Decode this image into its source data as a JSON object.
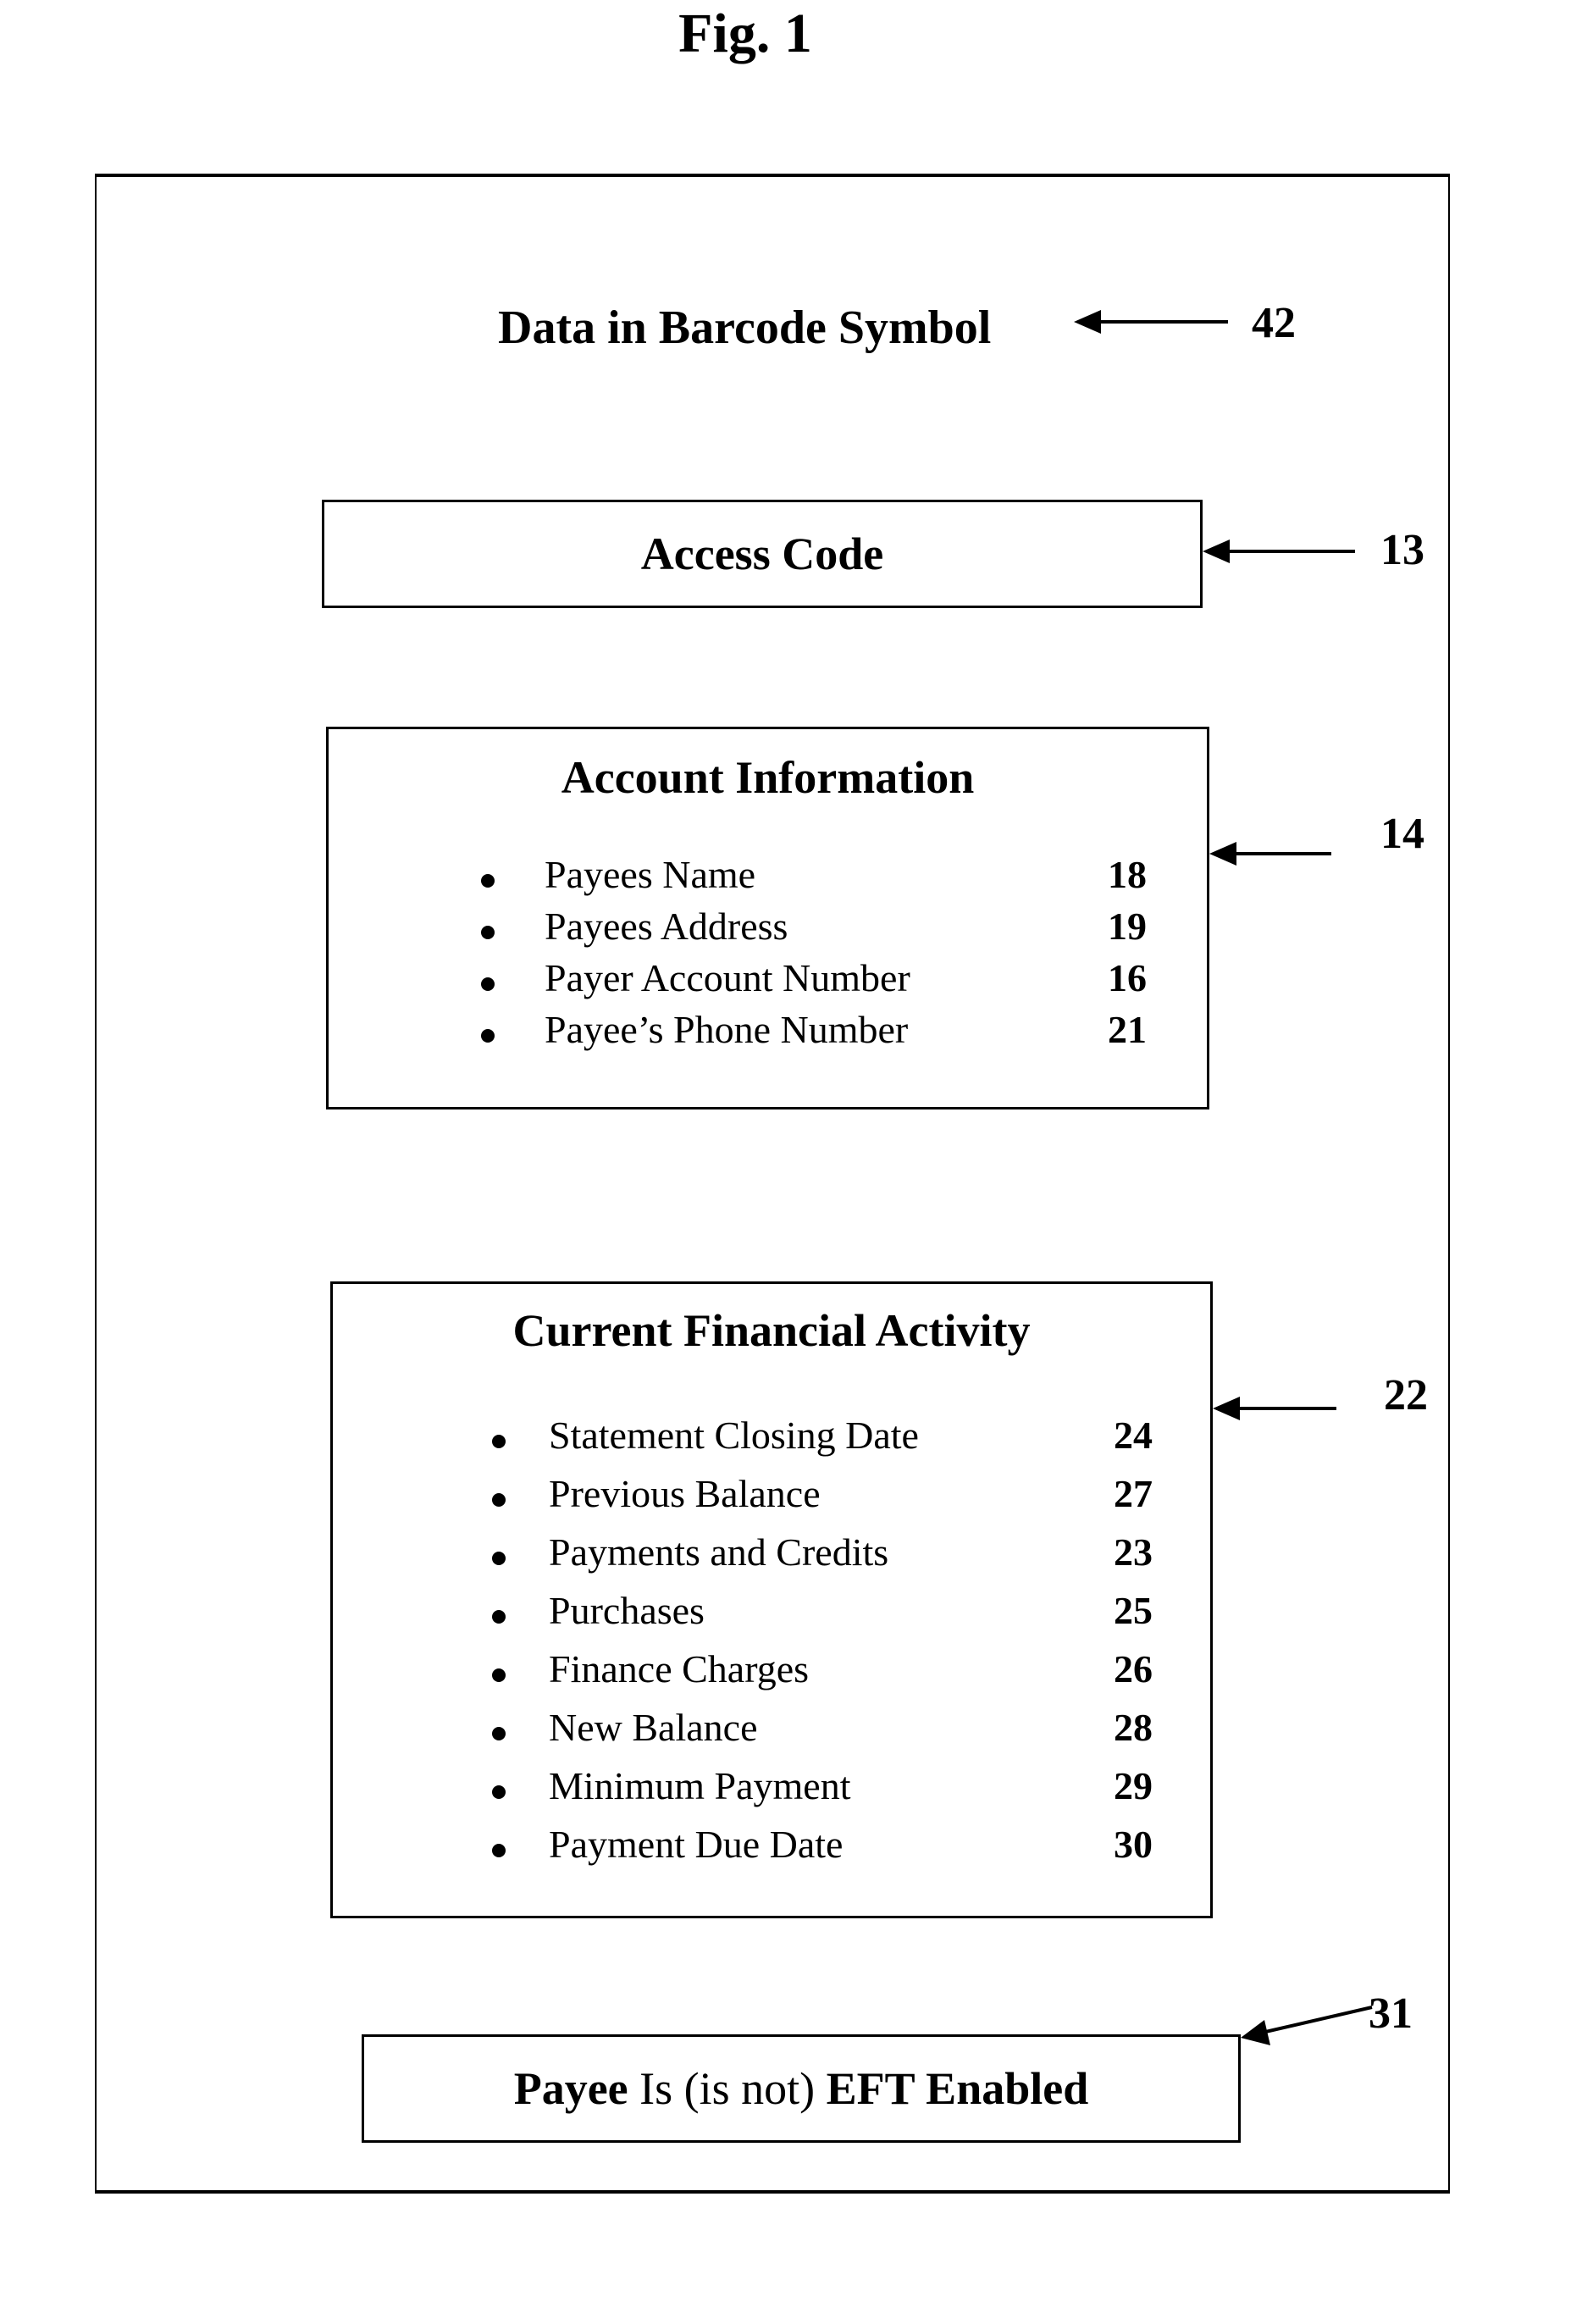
{
  "figure": {
    "title": "Fig. 1",
    "heading": {
      "text": "Data in Barcode Symbol",
      "ref": "42"
    },
    "access_code": {
      "title": "Access Code",
      "ref": "13"
    },
    "account_information": {
      "title": "Account Information",
      "ref": "14",
      "items": [
        {
          "label": "Payees Name",
          "ref": "18"
        },
        {
          "label": "Payees Address",
          "ref": "19"
        },
        {
          "label": "Payer Account Number",
          "ref": "16"
        },
        {
          "label": "Payee’s Phone Number",
          "ref": "21"
        }
      ]
    },
    "current_financial_activity": {
      "title": "Current Financial Activity",
      "ref": "22",
      "items": [
        {
          "label": "Statement Closing Date",
          "ref": "24"
        },
        {
          "label": "Previous Balance",
          "ref": "27"
        },
        {
          "label": "Payments and Credits",
          "ref": "23"
        },
        {
          "label": "Purchases",
          "ref": "25"
        },
        {
          "label": "Finance Charges",
          "ref": "26"
        },
        {
          "label": "New Balance",
          "ref": "28"
        },
        {
          "label": "Minimum Payment",
          "ref": "29"
        },
        {
          "label": "Payment Due Date",
          "ref": "30"
        }
      ]
    },
    "eft_status": {
      "part1": "Payee",
      "part2": " Is (is not) ",
      "part3": "EFT Enabled",
      "ref": "31"
    }
  }
}
